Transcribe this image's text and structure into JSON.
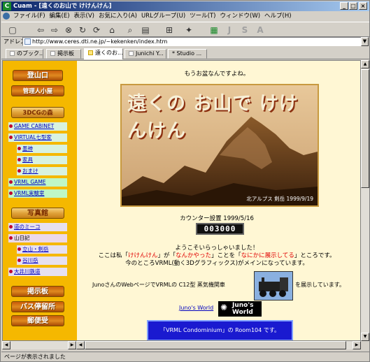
{
  "window": {
    "title": "Cuam - [遠くのお山で けけんけん]",
    "minimize": "_",
    "maximize": "□",
    "close": "×"
  },
  "menu": [
    "ファイル(F)",
    "編集(E)",
    "表示(V)",
    "お気に入り(A)",
    "URLグループ(U)",
    "ツール(T)",
    "ウィンドウ(W)",
    "ヘルプ(H)"
  ],
  "toolbar": {
    "icons": [
      "new-icon",
      "back-icon",
      "forward-icon",
      "stop-icon",
      "refresh-icon",
      "refresh-all-icon",
      "home-icon",
      "search-icon",
      "favorites-icon",
      "tile-icon",
      "tools-icon",
      "green-grid-icon"
    ],
    "letters": [
      "J",
      "S",
      "A"
    ]
  },
  "address": {
    "label": "アドレス",
    "value": "http://www.ceres.dti.ne.jp/~kekenken/index.htm"
  },
  "tabs": [
    {
      "label": "のブック..."
    },
    {
      "label": "掲示板"
    },
    {
      "label": "遠くのお..."
    },
    {
      "label": "Junichi Y..."
    },
    {
      "label": "* Studio ..."
    }
  ],
  "sidebar": {
    "btn1": "登山口",
    "btn2": "管理人小屋",
    "section_3dcg": "3DCGの森",
    "item_game": "GAME CABINET",
    "item_virtual": "VIRTUAL七型家",
    "item_kanji": "墨神",
    "item_kagu": "家具",
    "item_omake": "おまけ",
    "item_vrml_game": "VRML GAME",
    "item_vrml_lab": "VRML実験室",
    "section_photo": "写真館",
    "item_michi": "道のミーコ",
    "item_yama": "山日記",
    "item_tateyama": "立山・剣岳",
    "item_tanigawa": "谷川岳",
    "item_oigawa": "大井川鉄道",
    "btn_bbs": "掲示板",
    "btn_bus": "バス停留所",
    "btn_post": "郵便受"
  },
  "main": {
    "intro": "もうお盆なんですよね。",
    "banner_title": "遠くの お山で けけんけん",
    "banner_caption": "北アルプス 剣岳 1999/9/19",
    "counter_label": "カウンター設置 1999/5/16",
    "counter_value": "003000",
    "welcome_1": "ようこそいらっしゃいました！",
    "welcome_2_a": "ここは私「",
    "welcome_2_name": "けけんけん",
    "welcome_2_b": "」が「",
    "welcome_2_c": "なんかやった",
    "welcome_2_d": "」ことを「",
    "welcome_2_e": "なにかに展示してる",
    "welcome_2_f": "」ところです。",
    "welcome_3": "今のところVRML(動く3Dグラフィックス)がメインになっています。",
    "juno_text": "JunoさんのWebページでVRMLの C12型 蒸気機関車",
    "juno_text_b": "を展示しています。",
    "juno_link": "Juno's World",
    "juno_logo": "Juno's World",
    "condo": "「VRML Condominium」の Room104 です。"
  },
  "status": "ページが表示されました",
  "colors": {
    "sidebar_bg": "#f5b800",
    "content_bg": "#fff7d4",
    "title_bar": "#0a246a",
    "link": "#0000c0"
  }
}
